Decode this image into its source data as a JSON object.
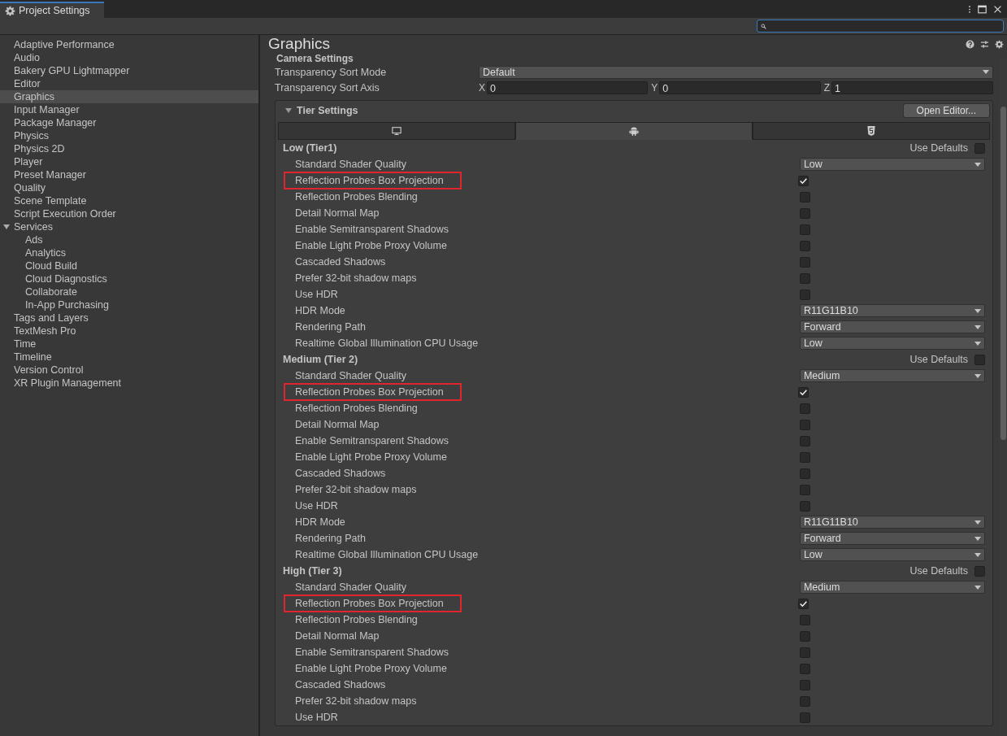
{
  "window": {
    "tab_title": "Project Settings"
  },
  "sidebar": {
    "items": [
      {
        "label": "Adaptive Performance",
        "selected": false
      },
      {
        "label": "Audio",
        "selected": false
      },
      {
        "label": "Bakery GPU Lightmapper",
        "selected": false
      },
      {
        "label": "Editor",
        "selected": false
      },
      {
        "label": "Graphics",
        "selected": true
      },
      {
        "label": "Input Manager",
        "selected": false
      },
      {
        "label": "Package Manager",
        "selected": false
      },
      {
        "label": "Physics",
        "selected": false
      },
      {
        "label": "Physics 2D",
        "selected": false
      },
      {
        "label": "Player",
        "selected": false
      },
      {
        "label": "Preset Manager",
        "selected": false
      },
      {
        "label": "Quality",
        "selected": false
      },
      {
        "label": "Scene Template",
        "selected": false
      },
      {
        "label": "Script Execution Order",
        "selected": false
      },
      {
        "label": "Services",
        "selected": false,
        "expanded": true,
        "children": [
          {
            "label": "Ads",
            "selected": false
          },
          {
            "label": "Analytics",
            "selected": false
          },
          {
            "label": "Cloud Build",
            "selected": false
          },
          {
            "label": "Cloud Diagnostics",
            "selected": false
          },
          {
            "label": "Collaborate",
            "selected": false
          },
          {
            "label": "In-App Purchasing",
            "selected": false
          }
        ]
      },
      {
        "label": "Tags and Layers",
        "selected": false
      },
      {
        "label": "TextMesh Pro",
        "selected": false
      },
      {
        "label": "Time",
        "selected": false
      },
      {
        "label": "Timeline",
        "selected": false
      },
      {
        "label": "Version Control",
        "selected": false
      },
      {
        "label": "XR Plugin Management",
        "selected": false
      }
    ]
  },
  "page": {
    "title": "Graphics",
    "section": "Camera Settings",
    "sort_mode": {
      "label": "Transparency Sort Mode",
      "value": "Default"
    },
    "sort_axis": {
      "label": "Transparency Sort Axis",
      "fields": [
        {
          "axis": "X",
          "value": "0"
        },
        {
          "axis": "Y",
          "value": "0"
        },
        {
          "axis": "Z",
          "value": "1"
        }
      ]
    }
  },
  "tier_settings": {
    "title": "Tier Settings",
    "expanded": true,
    "button": "Open Editor...",
    "tabs": [
      {
        "kind": "monitor",
        "selected": false
      },
      {
        "kind": "robot",
        "selected": true
      },
      {
        "kind": "shield",
        "selected": false
      }
    ],
    "tiers": [
      {
        "title": "Low (Tier1)",
        "defaults_label": "Use Defaults",
        "use_defaults": false,
        "rows": [
          {
            "kind": "dropdown",
            "label": "Standard Shader Quality",
            "value": "Low",
            "highlighted": false
          },
          {
            "kind": "checkbox",
            "label": "Reflection Probes Box Projection",
            "checked": true,
            "highlighted": true
          },
          {
            "kind": "checkbox",
            "label": "Reflection Probes Blending",
            "checked": false,
            "highlighted": false
          },
          {
            "kind": "checkbox",
            "label": "Detail Normal Map",
            "checked": false,
            "highlighted": false
          },
          {
            "kind": "checkbox",
            "label": "Enable Semitransparent Shadows",
            "checked": false,
            "highlighted": false
          },
          {
            "kind": "checkbox",
            "label": "Enable Light Probe Proxy Volume",
            "checked": false,
            "highlighted": false
          },
          {
            "kind": "checkbox",
            "label": "Cascaded Shadows",
            "checked": false,
            "highlighted": false
          },
          {
            "kind": "checkbox",
            "label": "Prefer 32-bit shadow maps",
            "checked": false,
            "highlighted": false
          },
          {
            "kind": "checkbox",
            "label": "Use HDR",
            "checked": false,
            "highlighted": false
          },
          {
            "kind": "dropdown",
            "label": "HDR Mode",
            "value": "R11G11B10",
            "highlighted": false
          },
          {
            "kind": "dropdown",
            "label": "Rendering Path",
            "value": "Forward",
            "highlighted": false
          },
          {
            "kind": "dropdown",
            "label": "Realtime Global Illumination CPU Usage",
            "value": "Low",
            "highlighted": false
          }
        ]
      },
      {
        "title": "Medium (Tier 2)",
        "defaults_label": "Use Defaults",
        "use_defaults": false,
        "rows": [
          {
            "kind": "dropdown",
            "label": "Standard Shader Quality",
            "value": "Medium",
            "highlighted": false
          },
          {
            "kind": "checkbox",
            "label": "Reflection Probes Box Projection",
            "checked": true,
            "highlighted": true
          },
          {
            "kind": "checkbox",
            "label": "Reflection Probes Blending",
            "checked": false,
            "highlighted": false
          },
          {
            "kind": "checkbox",
            "label": "Detail Normal Map",
            "checked": false,
            "highlighted": false
          },
          {
            "kind": "checkbox",
            "label": "Enable Semitransparent Shadows",
            "checked": false,
            "highlighted": false
          },
          {
            "kind": "checkbox",
            "label": "Enable Light Probe Proxy Volume",
            "checked": false,
            "highlighted": false
          },
          {
            "kind": "checkbox",
            "label": "Cascaded Shadows",
            "checked": false,
            "highlighted": false
          },
          {
            "kind": "checkbox",
            "label": "Prefer 32-bit shadow maps",
            "checked": false,
            "highlighted": false
          },
          {
            "kind": "checkbox",
            "label": "Use HDR",
            "checked": false,
            "highlighted": false
          },
          {
            "kind": "dropdown",
            "label": "HDR Mode",
            "value": "R11G11B10",
            "highlighted": false
          },
          {
            "kind": "dropdown",
            "label": "Rendering Path",
            "value": "Forward",
            "highlighted": false
          },
          {
            "kind": "dropdown",
            "label": "Realtime Global Illumination CPU Usage",
            "value": "Low",
            "highlighted": false
          }
        ]
      },
      {
        "title": "High (Tier 3)",
        "defaults_label": "Use Defaults",
        "use_defaults": false,
        "rows": [
          {
            "kind": "dropdown",
            "label": "Standard Shader Quality",
            "value": "Medium",
            "highlighted": false
          },
          {
            "kind": "checkbox",
            "label": "Reflection Probes Box Projection",
            "checked": true,
            "highlighted": true
          },
          {
            "kind": "checkbox",
            "label": "Reflection Probes Blending",
            "checked": false,
            "highlighted": false
          },
          {
            "kind": "checkbox",
            "label": "Detail Normal Map",
            "checked": false,
            "highlighted": false
          },
          {
            "kind": "checkbox",
            "label": "Enable Semitransparent Shadows",
            "checked": false,
            "highlighted": false
          },
          {
            "kind": "checkbox",
            "label": "Enable Light Probe Proxy Volume",
            "checked": false,
            "highlighted": false
          },
          {
            "kind": "checkbox",
            "label": "Cascaded Shadows",
            "checked": false,
            "highlighted": false
          },
          {
            "kind": "checkbox",
            "label": "Prefer 32-bit shadow maps",
            "checked": false,
            "highlighted": false
          },
          {
            "kind": "checkbox",
            "label": "Use HDR",
            "checked": false,
            "highlighted": false
          }
        ]
      }
    ]
  }
}
